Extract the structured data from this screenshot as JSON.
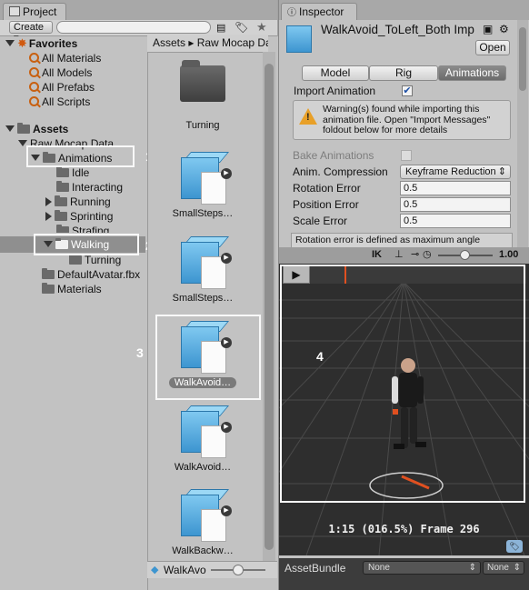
{
  "project": {
    "tab_label": "Project",
    "create_label": "Create",
    "favorites": {
      "label": "Favorites",
      "items": [
        "All Materials",
        "All Models",
        "All Prefabs",
        "All Scripts"
      ]
    },
    "assets": {
      "label": "Assets",
      "raw_mocap": "Raw Mocap Data",
      "animations": "Animations",
      "anim_children": [
        "Idle",
        "Interacting",
        "Running",
        "Sprinting",
        "Strafing"
      ],
      "walking": "Walking",
      "walking_children": [
        "Turning"
      ],
      "default_avatar": "DefaultAvatar.fbx",
      "materials": "Materials"
    },
    "breadcrumb": [
      "Assets",
      "Raw Mocap Data"
    ],
    "grid_items": [
      "Turning",
      "SmallSteps…",
      "SmallSteps…",
      "WalkAvoid…",
      "WalkAvoid…",
      "WalkBackw…"
    ],
    "bottom_label": "WalkAvo"
  },
  "annotations": [
    "1",
    "2",
    "3",
    "4"
  ],
  "inspector": {
    "tab_label": "Inspector",
    "title": "WalkAvoid_ToLeft_Both Imp",
    "open_label": "Open",
    "tabs": [
      "Model",
      "Rig",
      "Animations"
    ],
    "import_animation_label": "Import Animation",
    "import_animation_checked": true,
    "warning": "Warning(s) found while importing this animation file. Open \"Import Messages\" foldout below for more details",
    "bake_animations_label": "Bake Animations",
    "anim_compression_label": "Anim. Compression",
    "anim_compression_value": "Keyframe Reduction",
    "rotation_error_label": "Rotation Error",
    "rotation_error_value": "0.5",
    "position_error_label": "Position Error",
    "position_error_value": "0.5",
    "scale_error_label": "Scale Error",
    "scale_error_value": "0.5",
    "help_text": "Rotation error is defined as maximum angle",
    "preview": {
      "ik_label": "IK",
      "speed_value": "1.00",
      "time_label": "1:15 (016.5%) Frame 296"
    },
    "assetbundle_label": "AssetBundle",
    "assetbundle_value": "None",
    "assetbundle_variant": "None"
  }
}
